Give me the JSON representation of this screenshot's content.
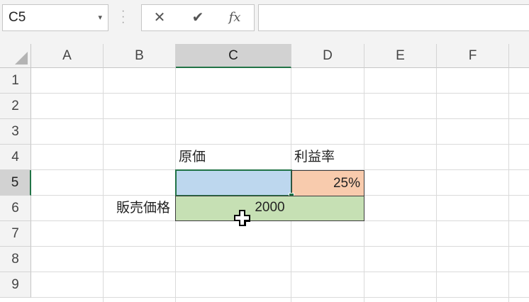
{
  "formula_bar": {
    "name_box": "C5",
    "name_box_arrow": "▾",
    "cancel_glyph": "✕",
    "enter_glyph": "✔",
    "function_glyph": "fx",
    "formula_value": ""
  },
  "columns": [
    "A",
    "B",
    "C",
    "D",
    "E",
    "F"
  ],
  "rows": [
    "1",
    "2",
    "3",
    "4",
    "5",
    "6",
    "7",
    "8",
    "9"
  ],
  "cells": {
    "C4": "原価",
    "D4": "利益率",
    "C5": "",
    "D5": "25%",
    "B6": "販売価格",
    "C6": "2000"
  },
  "selection": {
    "active_cell": "C5",
    "selected_column": "C",
    "selected_row": "5"
  },
  "colors": {
    "cell_blue": "#bdd7ee",
    "cell_orange": "#f8cbad",
    "cell_green": "#c6e0b4",
    "selection_green": "#217346"
  },
  "icons": [
    "dropdown-arrow-icon",
    "more-options-icon",
    "cancel-icon",
    "check-icon",
    "insert-function-icon",
    "select-all-icon",
    "plus-cursor-icon"
  ]
}
